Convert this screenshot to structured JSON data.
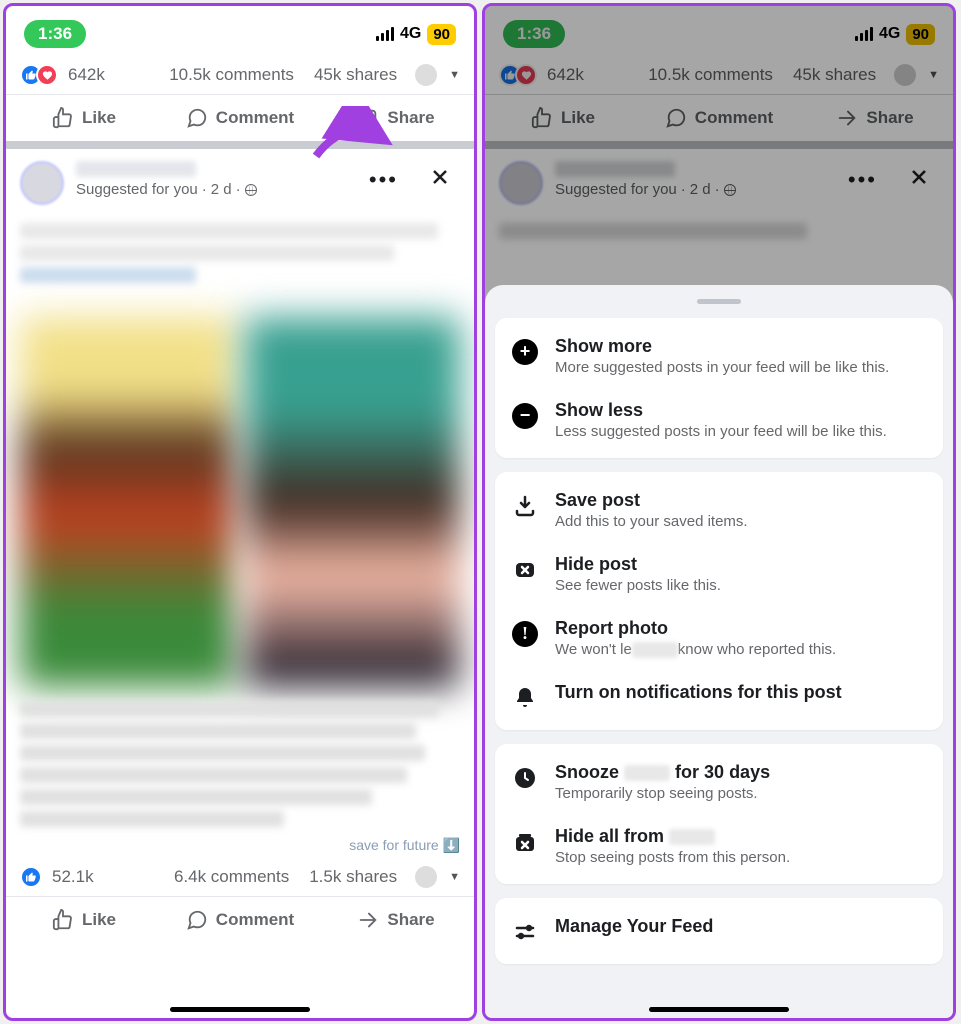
{
  "status": {
    "time": "1:36",
    "network": "4G",
    "battery": "90"
  },
  "post1": {
    "reactions": "642k",
    "comments": "10.5k comments",
    "shares": "45k shares"
  },
  "actions": {
    "like": "Like",
    "comment": "Comment",
    "share": "Share"
  },
  "suggested": {
    "label": "Suggested for you",
    "age": "2 d",
    "save_future": "save for future ⬇️"
  },
  "post2": {
    "reactions": "52.1k",
    "comments": "6.4k comments",
    "shares": "1.5k shares"
  },
  "sheet": {
    "show_more": {
      "title": "Show more",
      "sub": "More suggested posts in your feed will be like this."
    },
    "show_less": {
      "title": "Show less",
      "sub": "Less suggested posts in your feed will be like this."
    },
    "save": {
      "title": "Save post",
      "sub": "Add this to your saved items."
    },
    "hide": {
      "title": "Hide post",
      "sub": "See fewer posts like this."
    },
    "report": {
      "title": "Report photo",
      "sub_a": "We won't le",
      "sub_b": "know who reported this."
    },
    "notify": {
      "title": "Turn on notifications for this post"
    },
    "snooze": {
      "title_a": "Snooze",
      "title_b": "for 30 days",
      "sub": "Temporarily stop seeing posts."
    },
    "hide_all": {
      "title": "Hide all from",
      "sub": "Stop seeing posts from this person."
    },
    "manage": {
      "title": "Manage Your Feed"
    }
  }
}
